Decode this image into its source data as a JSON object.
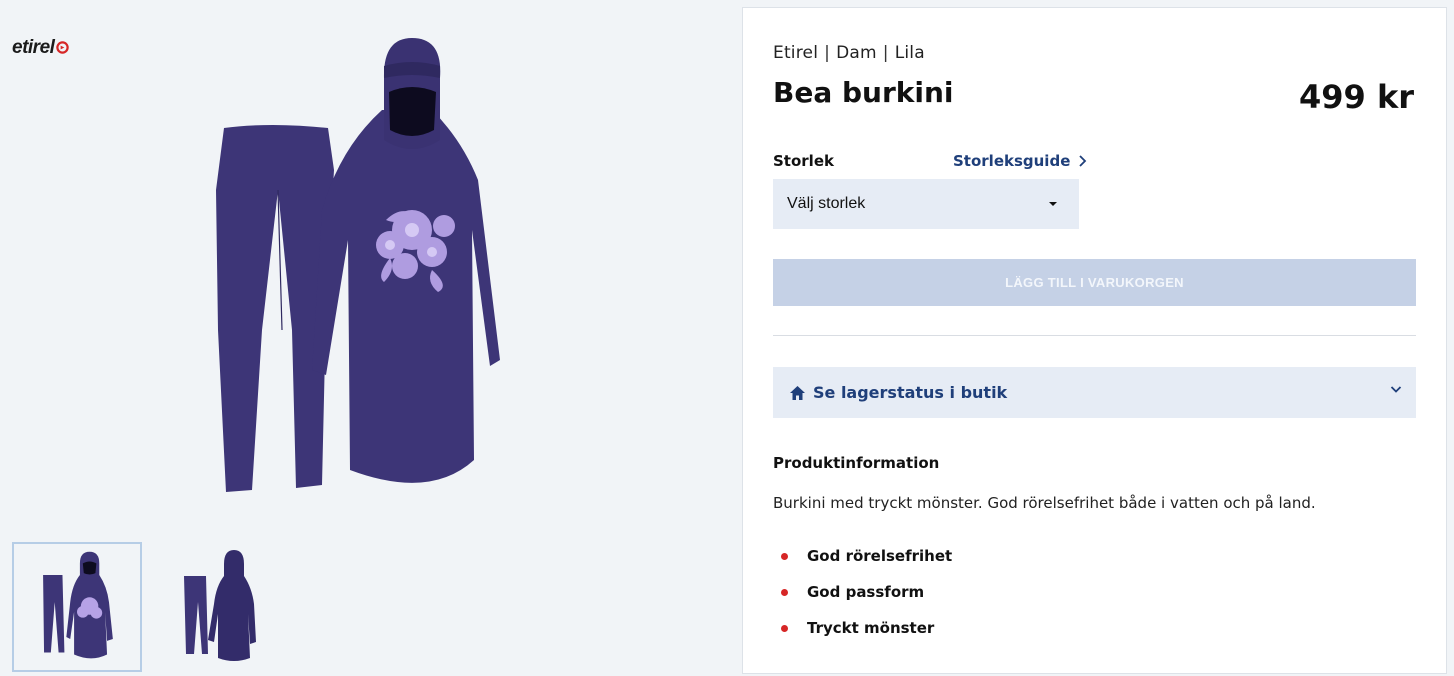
{
  "brand": {
    "logo_text": "etirel",
    "accent_color": "#d62626"
  },
  "gallery": {
    "main_image": "burkini-front-with-pants",
    "thumbnails": [
      {
        "name": "front-view",
        "selected": true
      },
      {
        "name": "back-view",
        "selected": false
      }
    ]
  },
  "product": {
    "breadcrumb": [
      "Etirel",
      "Dam",
      "Lila"
    ],
    "title": "Bea burkini",
    "price": "499 kr",
    "size_label": "Storlek",
    "size_guide": "Storleksguide",
    "size_select_value": "Välj storlek",
    "add_to_cart": "LÄGG TILL I VARUKORGEN",
    "stock_status": "Se lagerstatus i butik",
    "info_heading": "Produktinformation",
    "description": "Burkini med tryckt mönster. God rörelsefrihet både i vatten och på land.",
    "features": [
      "God rörelsefrihet",
      "God passform",
      "Tryckt mönster"
    ]
  },
  "colors": {
    "garment": "#3d3577",
    "link": "#1f3f7a",
    "button_disabled": "#c5d1e6",
    "panel_tint": "#e6ecf5"
  }
}
